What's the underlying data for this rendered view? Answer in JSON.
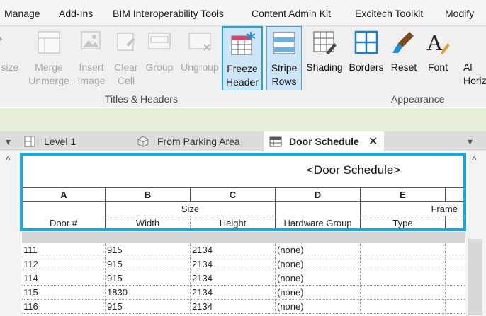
{
  "menu": [
    "Manage",
    "Add-Ins",
    "BIM Interoperability Tools",
    "Content Admin Kit",
    "Excitech Toolkit",
    "Modify"
  ],
  "ribbon": {
    "partial_left": "size",
    "merge": "Merge\nUnmerge",
    "insert_image": "Insert\nImage",
    "clear_cell": "Clear\nCell",
    "group": "Group",
    "ungroup": "Ungroup",
    "freeze_header": "Freeze\nHeader",
    "stripe_rows": "Stripe\nRows",
    "shading": "Shading",
    "borders": "Borders",
    "reset": "Reset",
    "font": "Font",
    "partial_right": "Al\nHoriz"
  },
  "panels": {
    "titles_headers": "Titles & Headers",
    "appearance": "Appearance"
  },
  "tabs": {
    "level1": "Level 1",
    "parking": "From Parking Area",
    "door_schedule": "Door Schedule",
    "close": "✕"
  },
  "schedule": {
    "title": "<Door Schedule>",
    "letters": [
      "A",
      "B",
      "C",
      "D",
      "E"
    ],
    "group_size": "Size",
    "group_frame": "Frame",
    "headers": [
      "Door #",
      "Width",
      "Height",
      "Hardware Group",
      "Type"
    ],
    "rows": [
      [
        "111",
        "915",
        "2134",
        "(none)"
      ],
      [
        "112",
        "915",
        "2134",
        "(none)"
      ],
      [
        "114",
        "915",
        "2134",
        "(none)"
      ],
      [
        "115",
        "1830",
        "2134",
        "(none)"
      ],
      [
        "116",
        "915",
        "2134",
        "(none)"
      ]
    ]
  },
  "colors": {
    "accent": "#1aa6e0",
    "active_fill": "#cde6f7",
    "green_bar": "#e6efd9"
  }
}
